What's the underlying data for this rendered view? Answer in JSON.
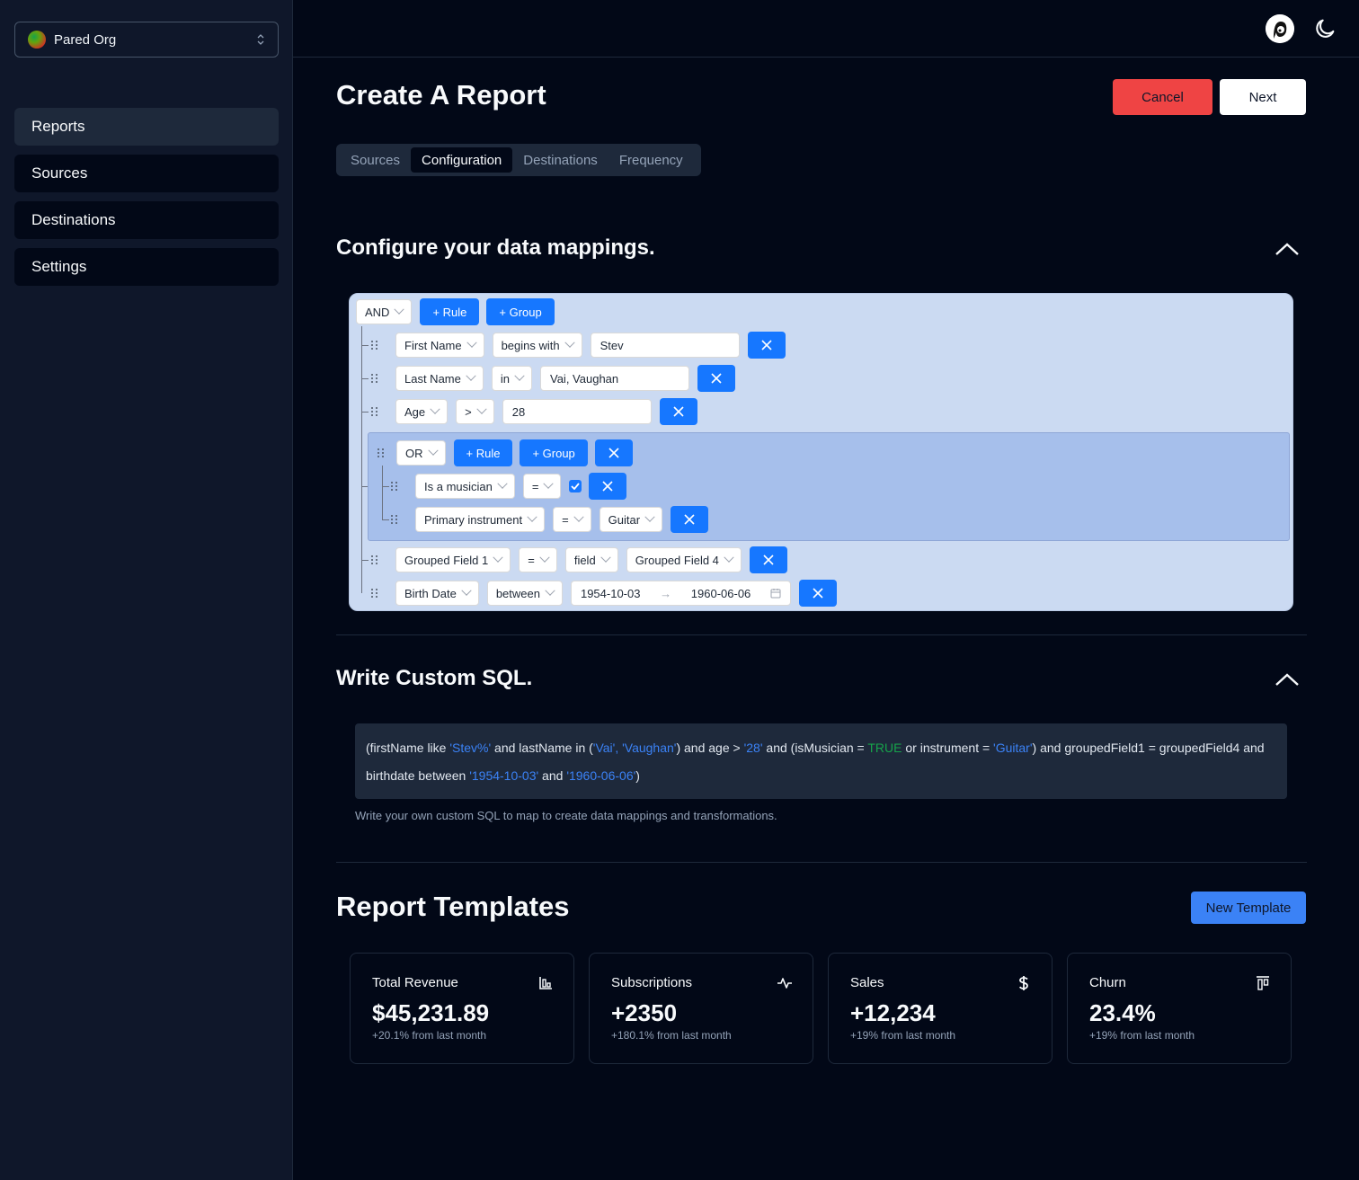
{
  "sidebar": {
    "org_name": "Pared Org",
    "items": [
      {
        "label": "Reports"
      },
      {
        "label": "Sources"
      },
      {
        "label": "Destinations"
      },
      {
        "label": "Settings"
      }
    ]
  },
  "page": {
    "title": "Create A Report",
    "cancel_label": "Cancel",
    "next_label": "Next",
    "tabs": [
      {
        "label": "Sources"
      },
      {
        "label": "Configuration"
      },
      {
        "label": "Destinations"
      },
      {
        "label": "Frequency"
      }
    ]
  },
  "mappings": {
    "title": "Configure your data mappings.",
    "combinator": "AND",
    "add_rule": "+ Rule",
    "add_group": "+ Group",
    "rules": [
      {
        "field": "First Name",
        "operator": "begins with",
        "value": "Stev"
      },
      {
        "field": "Last Name",
        "operator": "in",
        "value": "Vai, Vaughan"
      },
      {
        "field": "Age",
        "operator": ">",
        "value": "28"
      },
      {
        "field": "Grouped Field 1",
        "operator": "=",
        "value_source": "field",
        "value": "Grouped Field 4"
      },
      {
        "field": "Birth Date",
        "operator": "between",
        "value_start": "1954-10-03",
        "value_end": "1960-06-06"
      }
    ],
    "group": {
      "combinator": "OR",
      "add_rule": "+ Rule",
      "add_group": "+ Group",
      "rules": [
        {
          "field": "Is a musician",
          "operator": "=",
          "checked": true
        },
        {
          "field": "Primary instrument",
          "operator": "=",
          "value": "Guitar"
        }
      ]
    }
  },
  "sql": {
    "title": "Write Custom SQL.",
    "parts": {
      "p1": "(firstName like ",
      "s1": "'Stev%'",
      "p2": " and lastName in (",
      "s2": "'Vai', 'Vaughan'",
      "p3": ") and age > ",
      "s3": "'28'",
      "p4": " and (isMusician = ",
      "t1": "TRUE",
      "p5": " or instrument = ",
      "s4": "'Guitar'",
      "p6": ") and groupedField1 = groupedField4 and birthdate between ",
      "s5": "'1954-10-03'",
      "p7": " and ",
      "s6": "'1960-06-06'",
      "p8": ")"
    },
    "help": "Write your own custom SQL to map to create data mappings and transformations."
  },
  "templates": {
    "title": "Report Templates",
    "new_label": "New Template",
    "cards": [
      {
        "title": "Total Revenue",
        "value": "$45,231.89",
        "sub": "+20.1% from last month",
        "icon": "bar-chart-icon"
      },
      {
        "title": "Subscriptions",
        "value": "+2350",
        "sub": "+180.1% from last month",
        "icon": "activity-icon"
      },
      {
        "title": "Sales",
        "value": "+12,234",
        "sub": "+19% from last month",
        "icon": "dollar-icon"
      },
      {
        "title": "Churn",
        "value": "23.4%",
        "sub": "+19% from last month",
        "icon": "align-top-icon"
      }
    ]
  }
}
